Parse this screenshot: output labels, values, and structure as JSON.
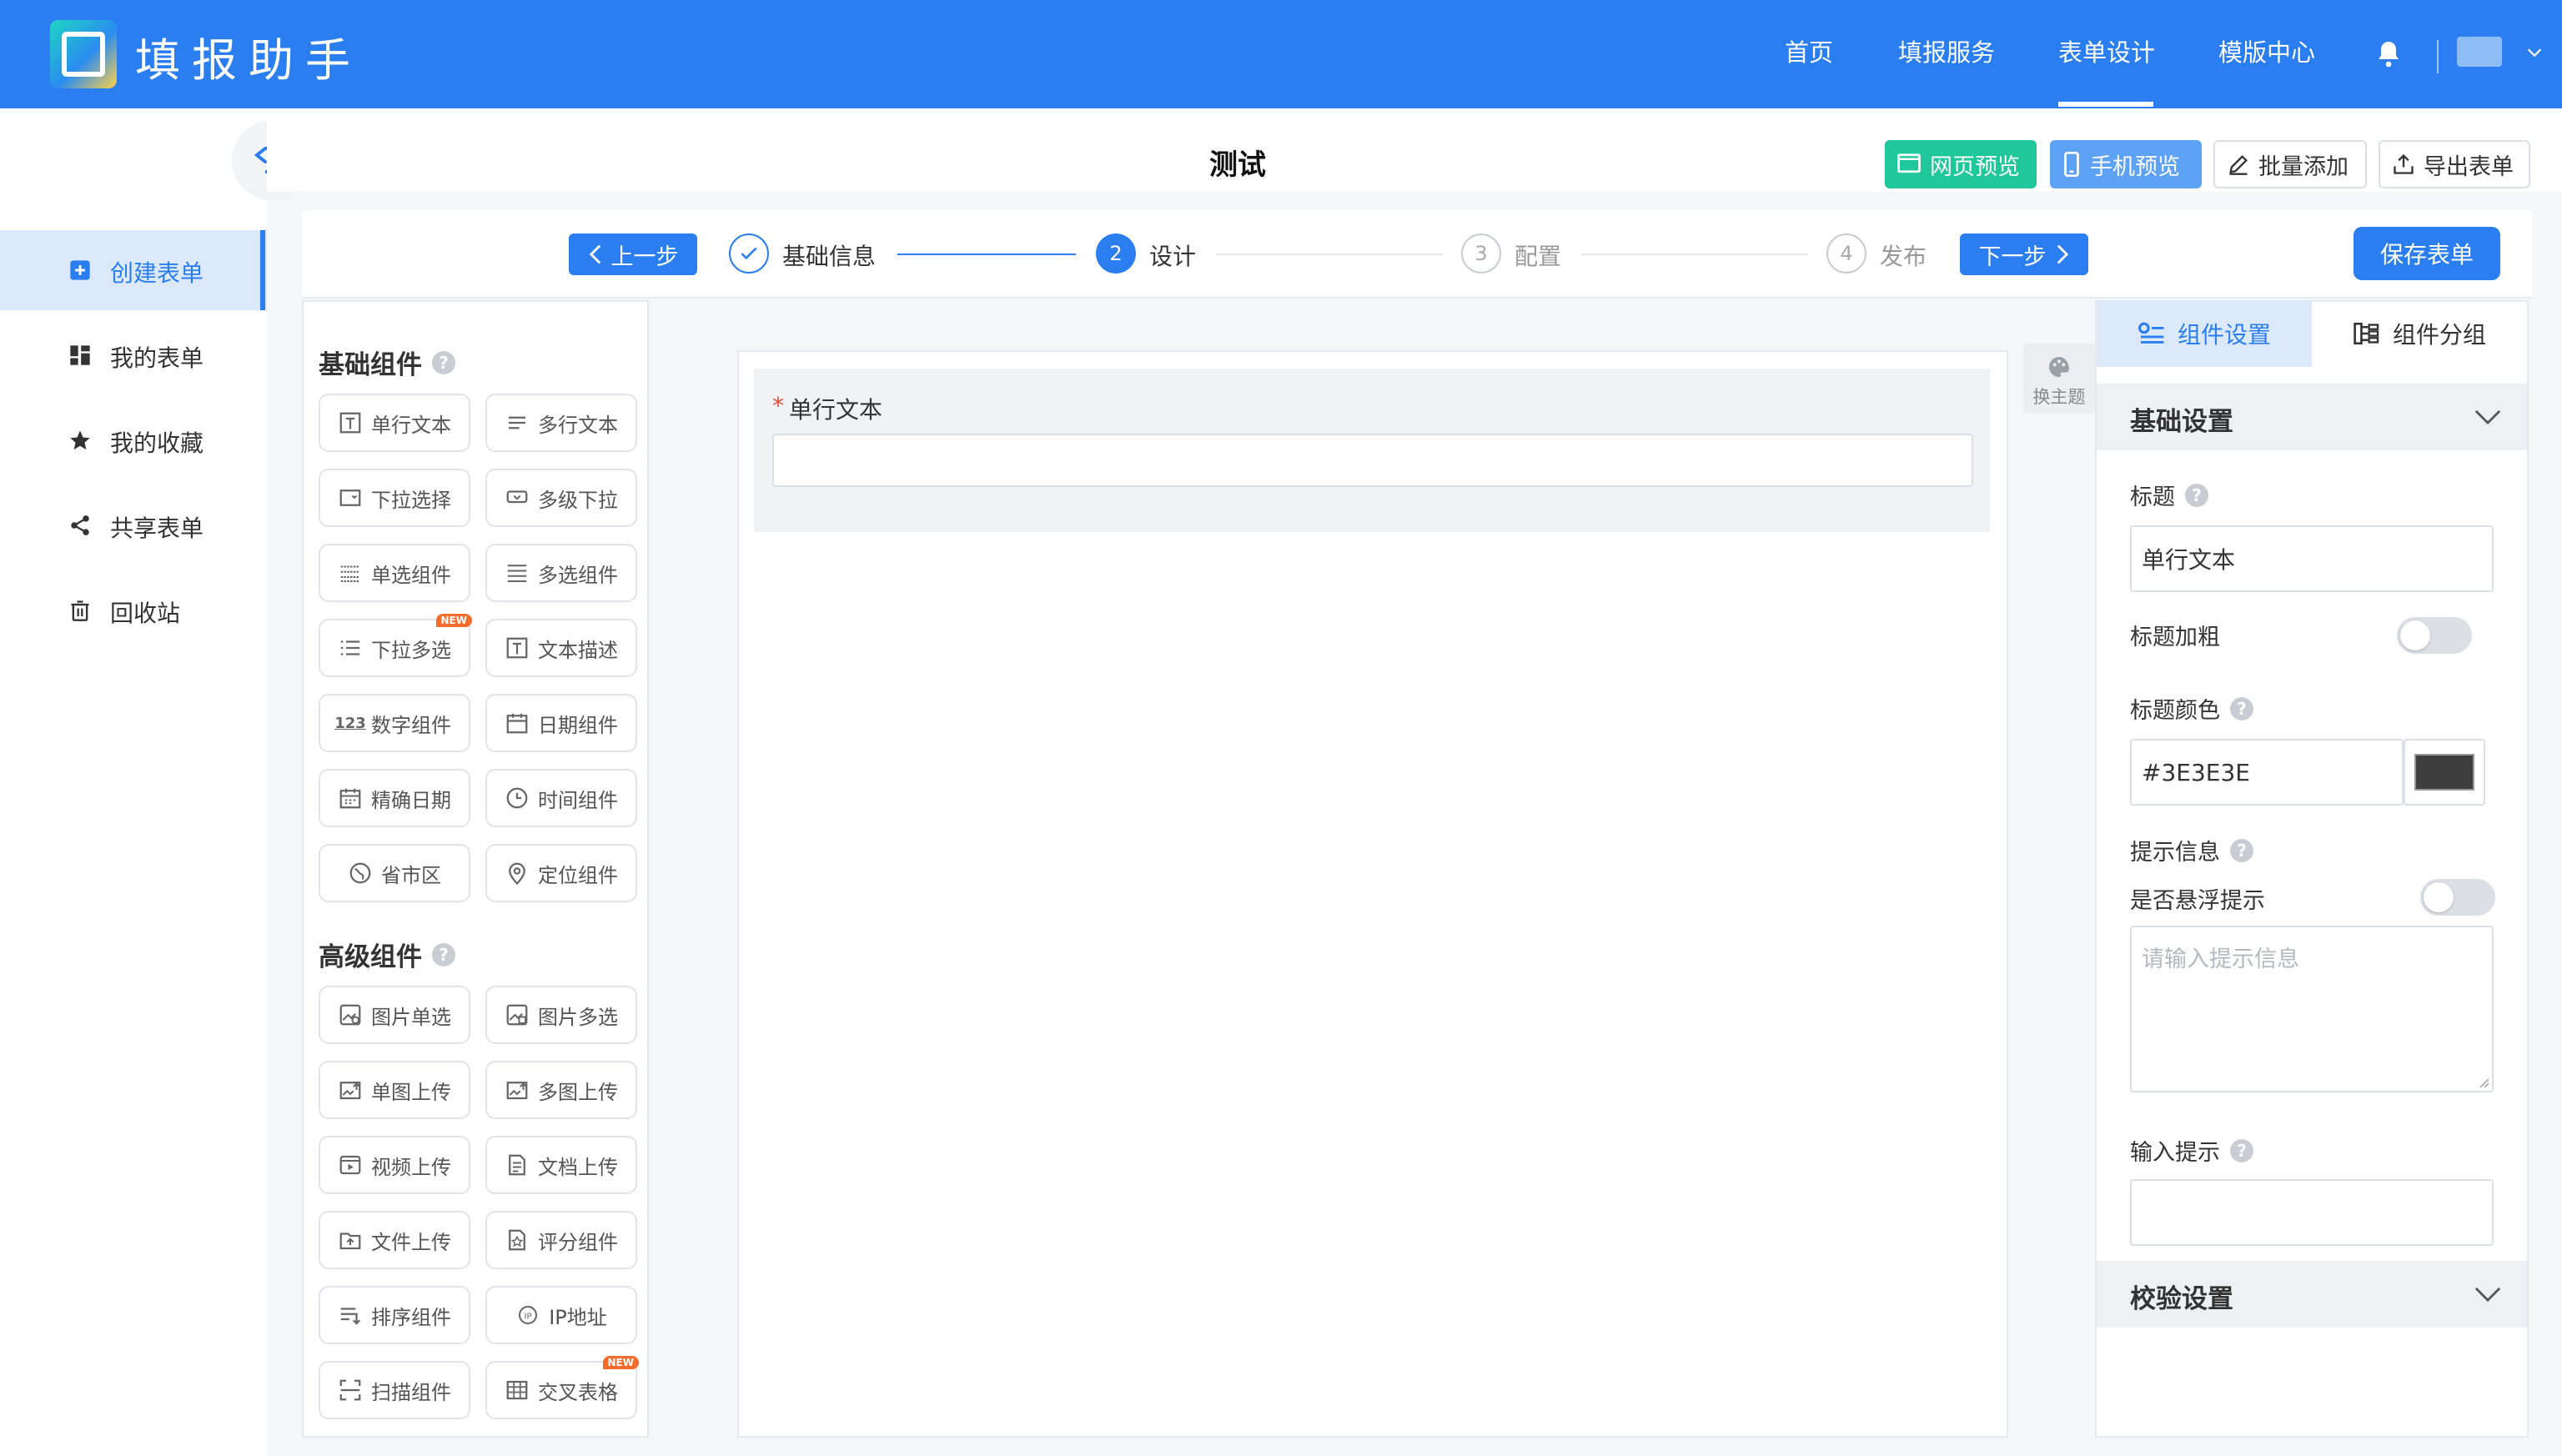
{
  "app": {
    "brand": "填报助手"
  },
  "nav": [
    "首页",
    "填报服务",
    "表单设计",
    "模版中心"
  ],
  "sidebar": {
    "items": [
      {
        "label": "创建表单",
        "icon": "plus-square-icon",
        "active": true
      },
      {
        "label": "我的表单",
        "icon": "grid-icon"
      },
      {
        "label": "我的收藏",
        "icon": "star-icon"
      },
      {
        "label": "共享表单",
        "icon": "share-icon"
      },
      {
        "label": "回收站",
        "icon": "trash-icon"
      }
    ]
  },
  "header": {
    "form_title": "测试",
    "buttons": {
      "web_preview": "网页预览",
      "mobile_preview": "手机预览",
      "batch_add": "批量添加",
      "export_form": "导出表单"
    },
    "colors": {
      "web_preview": "#1FC79A",
      "mobile_preview": "#5EA2F5",
      "accent": "#2A7EF0"
    }
  },
  "steps": {
    "prev": "上一步",
    "next": "下一步",
    "save": "保存表单",
    "items": [
      {
        "num": "✓",
        "label": "基础信息",
        "state": "done"
      },
      {
        "num": "2",
        "label": "设计",
        "state": "active"
      },
      {
        "num": "3",
        "label": "配置",
        "state": "pending"
      },
      {
        "num": "4",
        "label": "发布",
        "state": "pending"
      }
    ]
  },
  "components": {
    "basic_title": "基础组件",
    "basic": [
      "单行文本",
      "多行文本",
      "下拉选择",
      "多级下拉",
      "单选组件",
      "多选组件",
      "下拉多选",
      "文本描述",
      "数字组件",
      "日期组件",
      "精确日期",
      "时间组件",
      "省市区",
      "定位组件"
    ],
    "advanced_title": "高级组件",
    "advanced": [
      "图片单选",
      "图片多选",
      "单图上传",
      "多图上传",
      "视频上传",
      "文档上传",
      "文件上传",
      "评分组件",
      "排序组件",
      "IP地址",
      "扫描组件",
      "交叉表格"
    ],
    "new_badge": "NEW"
  },
  "canvas": {
    "field_label": "单行文本",
    "required_mark": "*",
    "theme_label": "换主题"
  },
  "settings": {
    "tabs": {
      "component_settings": "组件设置",
      "component_group": "组件分组"
    },
    "basic_section": "基础设置",
    "title_label": "标题",
    "title_value": "单行文本",
    "title_bold_label": "标题加粗",
    "title_bold": false,
    "title_color_label": "标题颜色",
    "title_color_value": "#3E3E3E",
    "tip_label": "提示信息",
    "hover_tip_label": "是否悬浮提示",
    "hover_tip": false,
    "tip_placeholder": "请输入提示信息",
    "input_hint_label": "输入提示",
    "input_hint_value": "",
    "validation_section": "校验设置"
  }
}
